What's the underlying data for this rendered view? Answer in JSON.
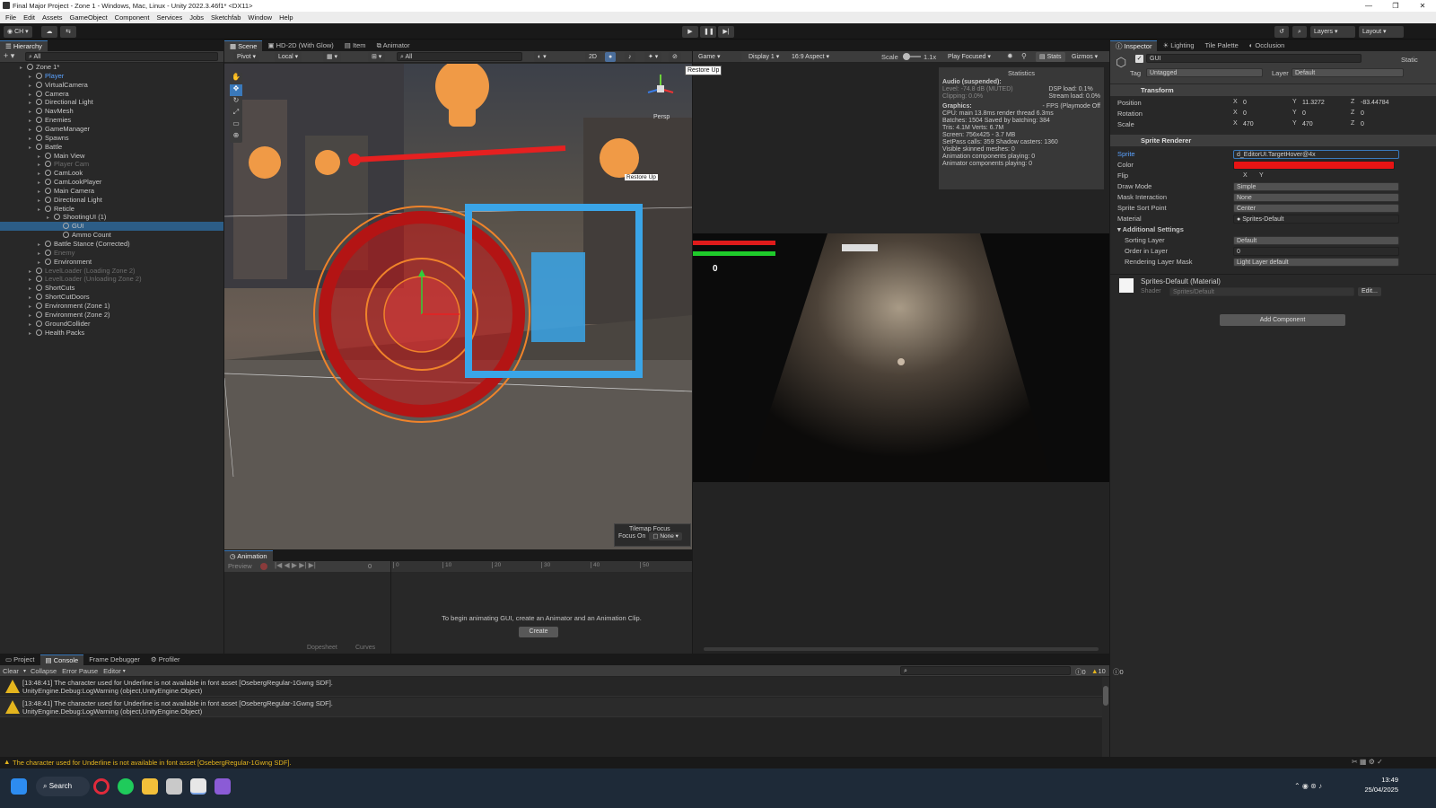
{
  "window": {
    "title": "Final Major Project - Zone 1 - Windows, Mac, Linux - Unity 2022.3.46f1* <DX11>",
    "controls": [
      "—",
      "❐",
      "✕"
    ]
  },
  "menu": [
    "File",
    "Edit",
    "Assets",
    "GameObject",
    "Component",
    "Services",
    "Jobs",
    "Sketchfab",
    "Window",
    "Help"
  ],
  "toolbar": {
    "account": "CH",
    "play_tooltip": "Restore Up",
    "layers": "Layers",
    "layout": "Layout"
  },
  "hierarchy": {
    "tab": "Hierarchy",
    "search": "All",
    "items": [
      {
        "label": "Zone 1*",
        "indent": 0,
        "state": "scene"
      },
      {
        "label": "Player",
        "indent": 1,
        "state": "blue"
      },
      {
        "label": "VirtualCamera",
        "indent": 1,
        "state": ""
      },
      {
        "label": "Camera",
        "indent": 1,
        "state": ""
      },
      {
        "label": "Directional Light",
        "indent": 1,
        "state": ""
      },
      {
        "label": "NavMesh",
        "indent": 1,
        "state": ""
      },
      {
        "label": "Enemies",
        "indent": 1,
        "state": ""
      },
      {
        "label": "GameManager",
        "indent": 1,
        "state": ""
      },
      {
        "label": "Spawns",
        "indent": 1,
        "state": ""
      },
      {
        "label": "Battle",
        "indent": 1,
        "state": ""
      },
      {
        "label": "Main View",
        "indent": 2,
        "state": ""
      },
      {
        "label": "Player Cam",
        "indent": 2,
        "state": "dim"
      },
      {
        "label": "CamLook",
        "indent": 2,
        "state": ""
      },
      {
        "label": "CamLookPlayer",
        "indent": 2,
        "state": ""
      },
      {
        "label": "Main Camera",
        "indent": 2,
        "state": ""
      },
      {
        "label": "Directional Light",
        "indent": 2,
        "state": ""
      },
      {
        "label": "Reticle",
        "indent": 2,
        "state": ""
      },
      {
        "label": "ShootingUI (1)",
        "indent": 3,
        "state": ""
      },
      {
        "label": "GUI",
        "indent": 4,
        "state": "sel"
      },
      {
        "label": "Ammo Count",
        "indent": 4,
        "state": ""
      },
      {
        "label": "Battle Stance (Corrected)",
        "indent": 2,
        "state": ""
      },
      {
        "label": "Enemy",
        "indent": 2,
        "state": "dim"
      },
      {
        "label": "Environment",
        "indent": 2,
        "state": ""
      },
      {
        "label": "LevelLoader (Loading Zone 2)",
        "indent": 1,
        "state": "dim"
      },
      {
        "label": "LevelLoader (Unloading Zone 2)",
        "indent": 1,
        "state": "dim"
      },
      {
        "label": "ShortCuts",
        "indent": 1,
        "state": ""
      },
      {
        "label": "ShortCutDoors",
        "indent": 1,
        "state": ""
      },
      {
        "label": "Environment (Zone 1)",
        "indent": 1,
        "state": ""
      },
      {
        "label": "Environment (Zone 2)",
        "indent": 1,
        "state": ""
      },
      {
        "label": "GroundCollider",
        "indent": 1,
        "state": ""
      },
      {
        "label": "Health Packs",
        "indent": 1,
        "state": ""
      }
    ]
  },
  "scene": {
    "tabs": [
      "Scene",
      "HD-2D (With Glow)",
      "Item",
      "Animator"
    ],
    "pivot": "Pivot",
    "local": "Local",
    "mode_2d": "2D",
    "search": "All",
    "persp": "Persp",
    "tooltip": "Restore Up",
    "tilemap_focus": "Tilemap Focus",
    "focus_on": "Focus On",
    "focus_value": "None"
  },
  "game": {
    "tab": "Game",
    "display": "Display 1",
    "aspect": "16:9 Aspect",
    "scale_label": "Scale",
    "scale_value": "1.1x",
    "play_focused": "Play Focused",
    "stats": "Stats",
    "gizmos": "Gizmos",
    "ammo": "0",
    "statistics": {
      "title": "Statistics",
      "audio_head": "Audio (suspended):",
      "audio": [
        "Level: -74.8 dB (MUTED)",
        "Clipping: 0.0%"
      ],
      "audio_right": [
        "DSP load: 0.1%",
        "Stream load: 0.0%"
      ],
      "graphics_head": "Graphics:",
      "fps": "- FPS (Playmode Off",
      "graphics": [
        "CPU: main 13.8ms  render thread 6.3ms",
        "Batches: 1504  Saved by batching: 384",
        "Tris: 4.1M          Verts: 6.7M",
        "Screen: 756x425 - 3.7 MB",
        "SetPass calls: 359       Shadow casters: 1360",
        "Visible skinned meshes: 0",
        "Animation components playing: 0",
        "Animator components playing: 0"
      ]
    }
  },
  "inspector": {
    "tabs": [
      "Inspector",
      "Lighting",
      "Tile Palette",
      "Occlusion"
    ],
    "object_name": "GUI",
    "static": "Static",
    "tag_label": "Tag",
    "tag": "Untagged",
    "layer_label": "Layer",
    "layer": "Default",
    "transform": {
      "title": "Transform",
      "rows": [
        {
          "label": "Position",
          "x": "0",
          "y": "11.3272",
          "z": "-83.44784"
        },
        {
          "label": "Rotation",
          "x": "0",
          "y": "0",
          "z": "0"
        },
        {
          "label": "Scale",
          "x": "470",
          "y": "470",
          "z": "0"
        }
      ]
    },
    "sprite_renderer": {
      "title": "Sprite Renderer",
      "sprite_label": "Sprite",
      "sprite": "d_EditorUI.TargetHover@4x",
      "color_label": "Color",
      "color": "#e81414",
      "flip_label": "Flip",
      "flip_x": "X",
      "flip_y": "Y",
      "rows": [
        {
          "label": "Draw Mode",
          "value": "Simple"
        },
        {
          "label": "Mask Interaction",
          "value": "None"
        },
        {
          "label": "Sprite Sort Point",
          "value": "Center"
        }
      ],
      "material_label": "Material",
      "material": "Sprites-Default",
      "additional": "Additional Settings",
      "rows2": [
        {
          "label": "Sorting Layer",
          "value": "Default",
          "dd": true
        },
        {
          "label": "Order in Layer",
          "value": "0",
          "dd": false
        },
        {
          "label": "Rendering Layer Mask",
          "value": "Light Layer default",
          "dd": true
        }
      ]
    },
    "material_block": {
      "name": "Sprites-Default (Material)",
      "shader_label": "Shader",
      "shader": "Sprites/Default",
      "edit": "Edit..."
    },
    "add_component": "Add Component"
  },
  "animation": {
    "tab": "Animation",
    "preview": "Preview",
    "frame": "0",
    "ticks": [
      "0",
      "10",
      "20",
      "30",
      "40",
      "50"
    ],
    "message": "To begin animating GUI, create an Animator and an Animation Clip.",
    "create": "Create",
    "dopesheet": "Dopesheet",
    "curves": "Curves"
  },
  "console": {
    "tabs": [
      "Project",
      "Console",
      "Frame Debugger",
      "Profiler"
    ],
    "buttons": [
      "Clear",
      "Collapse",
      "Error Pause",
      "Editor"
    ],
    "counts": {
      "info": "0",
      "warn": "10",
      "error": "0"
    },
    "logs": [
      {
        "line1": "[13:48:41] The character used for Underline is not available in font asset [OsebergRegular-1Gwng SDF].",
        "line2": "UnityEngine.Debug:LogWarning (object,UnityEngine.Object)"
      },
      {
        "line1": "[13:48:41] The character used for Underline is not available in font asset [OsebergRegular-1Gwng SDF].",
        "line2": "UnityEngine.Debug:LogWarning (object,UnityEngine.Object)"
      }
    ]
  },
  "statusbar": {
    "message": "The character used for Underline is not available in font asset [OsebergRegular-1Gwng SDF]."
  },
  "taskbar": {
    "search": "Search",
    "time": "13:49",
    "date": "25/04/2025"
  }
}
